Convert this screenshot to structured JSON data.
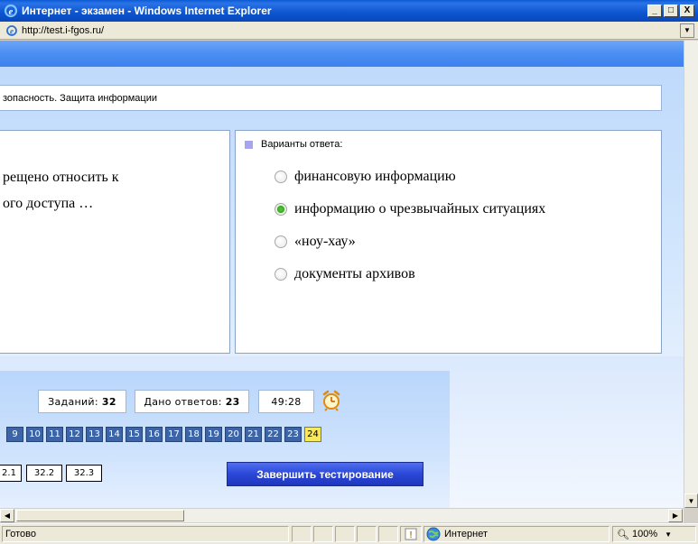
{
  "window": {
    "title": "Интернет - экзамен - Windows Internet Explorer",
    "minimize": "_",
    "maximize": "□",
    "close": "X"
  },
  "address": {
    "url": "http://test.i-fgos.ru/"
  },
  "subject": "зопасность. Защита информации",
  "question": {
    "lines": [
      "рещено относить к",
      "ого доступа …"
    ]
  },
  "answers": {
    "header": "Варианты ответа:",
    "options": [
      {
        "label": "финансовую информацию",
        "checked": false
      },
      {
        "label": "информацию о чрезвычайных ситуациях",
        "checked": true
      },
      {
        "label": "«ноу-хау»",
        "checked": false
      },
      {
        "label": "документы архивов",
        "checked": false
      }
    ]
  },
  "stats": {
    "tasks_label": "Заданий:",
    "tasks_value": "32",
    "answered_label": "Дано ответов:",
    "answered_value": "23",
    "timer": "49:28"
  },
  "task_numbers": [
    "9",
    "10",
    "11",
    "12",
    "13",
    "14",
    "15",
    "16",
    "17",
    "18",
    "19",
    "20",
    "21",
    "22",
    "23",
    "24"
  ],
  "current_task": "24",
  "subtasks": [
    "2.1",
    "32.2",
    "32.3"
  ],
  "finish_button": "Завершить тестирование",
  "status": {
    "text": "Готово",
    "zone": "Интернет",
    "zoom": "100%"
  }
}
